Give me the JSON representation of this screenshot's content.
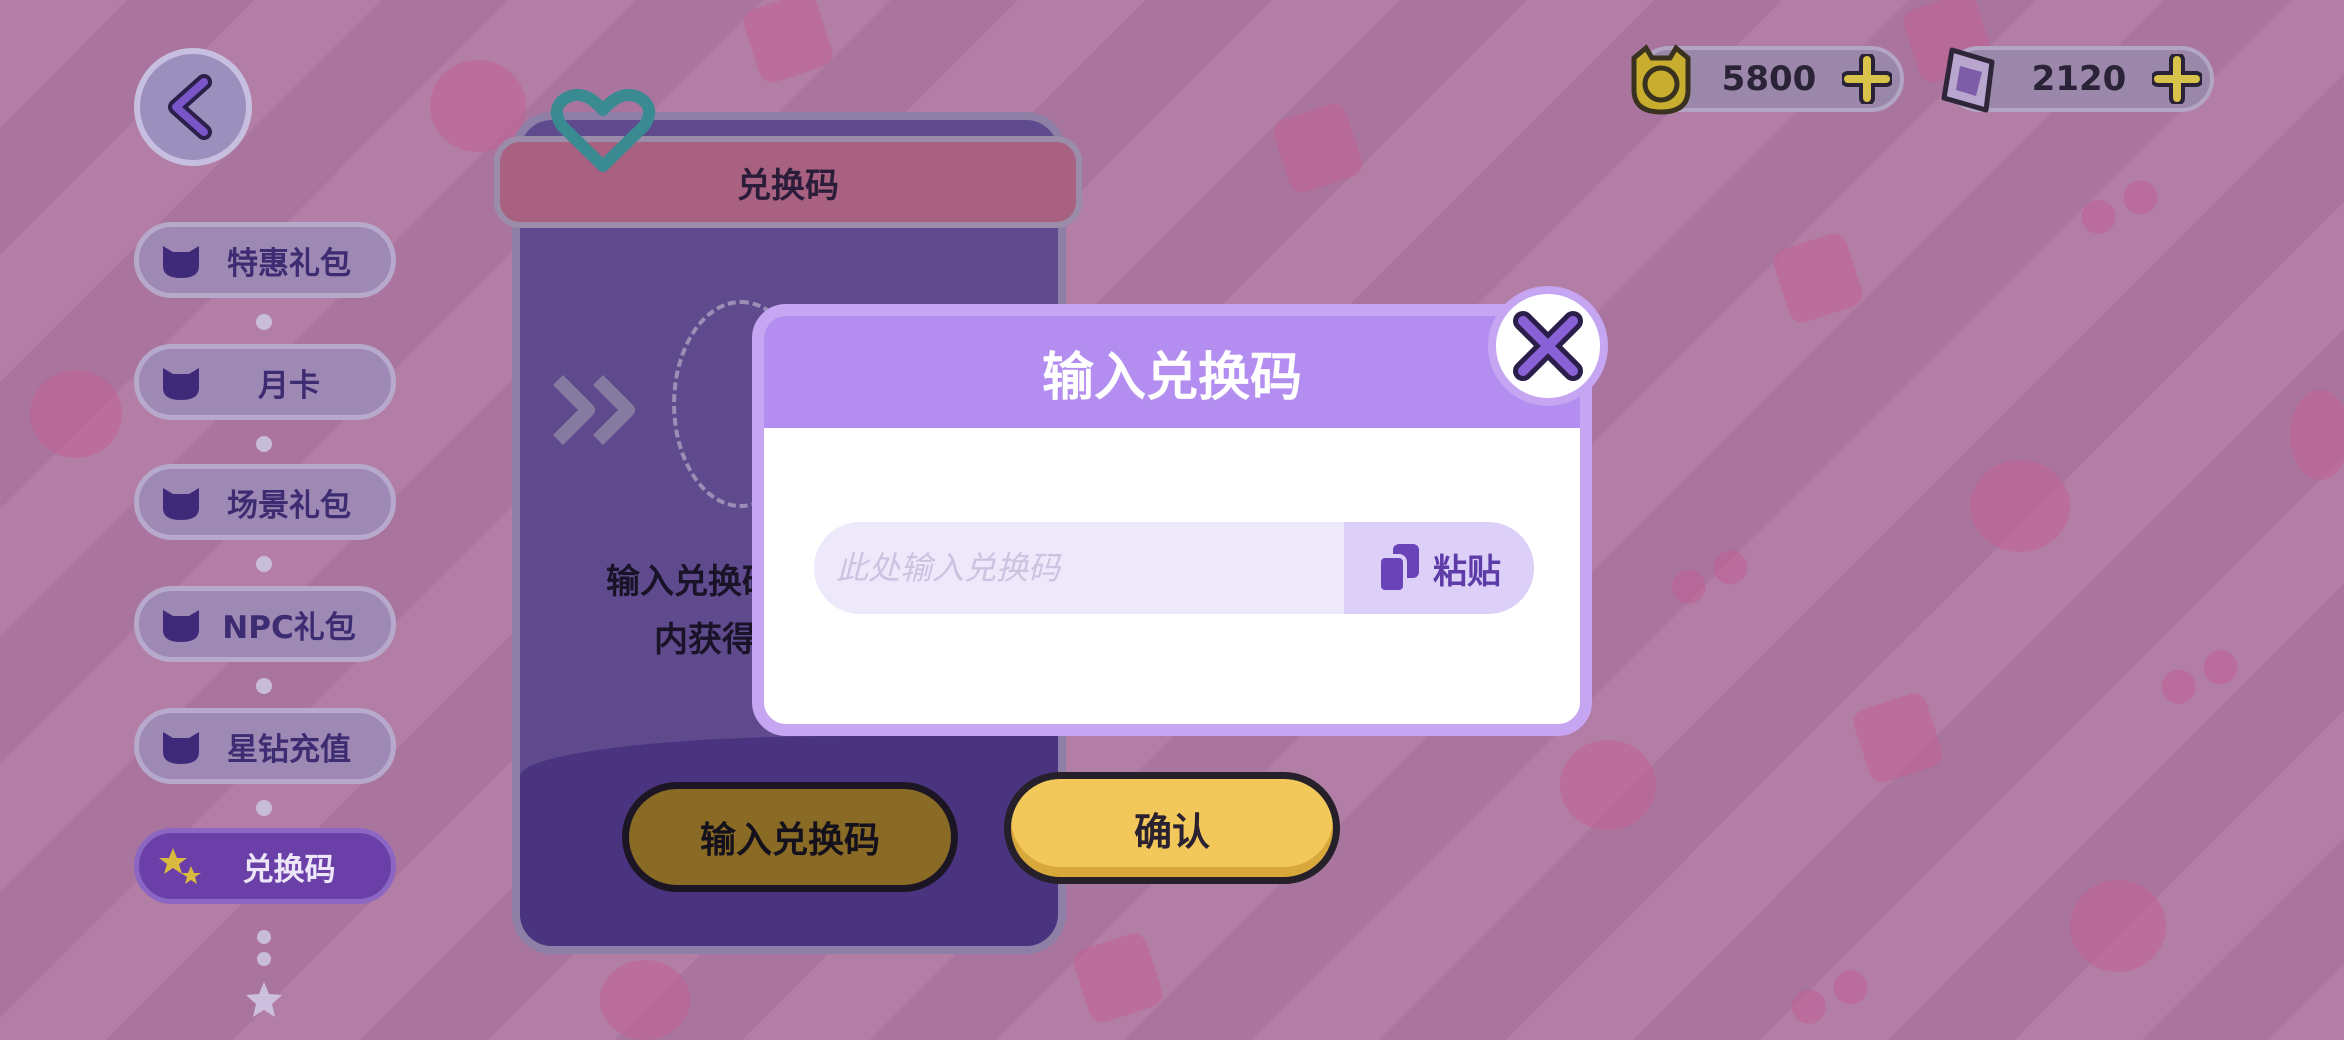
{
  "sidebar": {
    "items": [
      {
        "label": "特惠礼包",
        "active": false
      },
      {
        "label": "月卡",
        "active": false
      },
      {
        "label": "场景礼包",
        "active": false
      },
      {
        "label": "NPC礼包",
        "active": false
      },
      {
        "label": "星钻充值",
        "active": false
      },
      {
        "label": "兑换码",
        "active": true
      }
    ]
  },
  "panel": {
    "header": "兑换码",
    "desc_line1": "输入兑换码",
    "desc_line2": "内获得",
    "redeem_button": "输入兑换码"
  },
  "currency": {
    "gold": "5800",
    "diamond": "2120"
  },
  "modal": {
    "title": "输入兑换码",
    "input_placeholder": "此处输入兑换码",
    "paste_label": "粘贴",
    "confirm_label": "确认"
  },
  "colors": {
    "modal_header": "#b38ef0",
    "confirm_button": "#f3c85a",
    "active_tab": "#6a40a8"
  }
}
